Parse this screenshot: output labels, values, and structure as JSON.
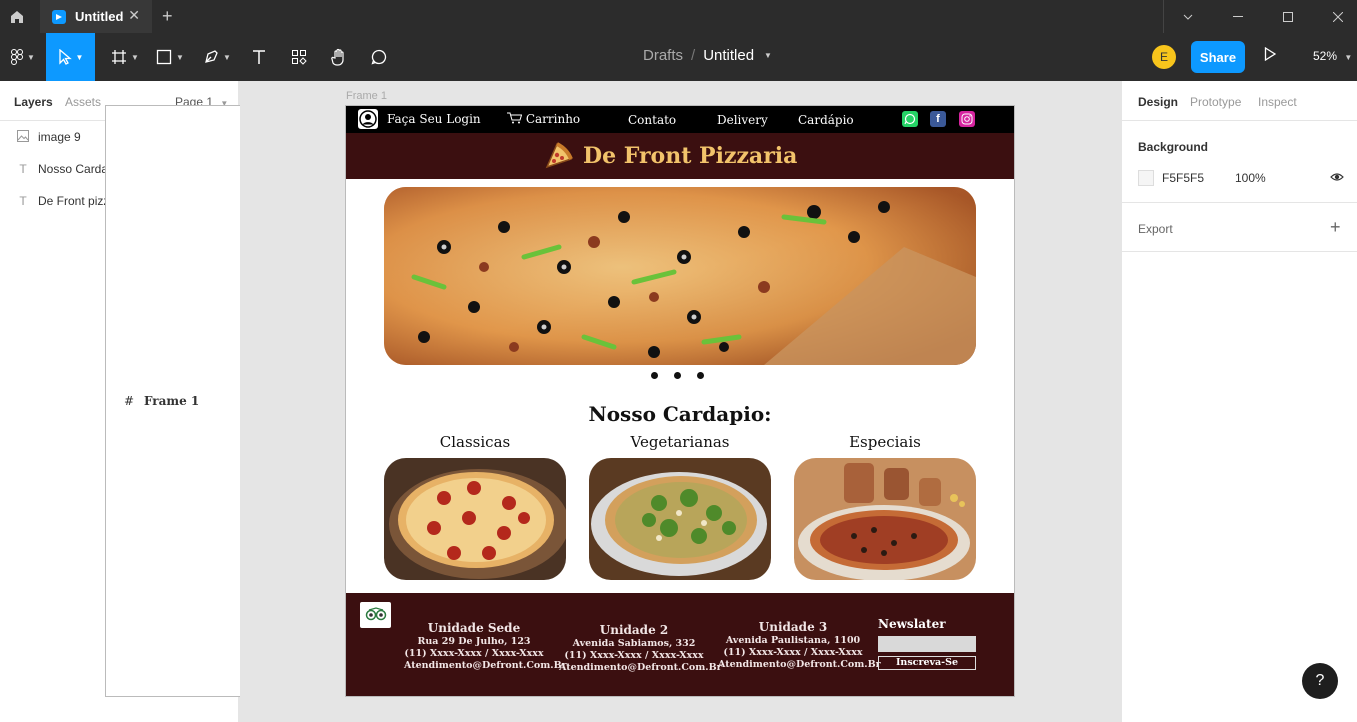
{
  "tab": {
    "title": "Untitled"
  },
  "toolbar": {
    "breadcrumb_parent": "Drafts",
    "breadcrumb_sep": "/",
    "file_name": "Untitled",
    "avatar_initial": "E",
    "share_label": "Share",
    "zoom": "52%"
  },
  "left_panel": {
    "tab_layers": "Layers",
    "tab_assets": "Assets",
    "page": "Page 1",
    "layers": [
      {
        "name": "image 9",
        "type": "image"
      },
      {
        "name": "Nosso Cardapio:",
        "type": "text"
      },
      {
        "name": "De Front pizzaria",
        "type": "text"
      },
      {
        "name": "Frame 1",
        "type": "frame"
      }
    ]
  },
  "right_panel": {
    "tab_design": "Design",
    "tab_prototype": "Prototype",
    "tab_inspect": "Inspect",
    "background_label": "Background",
    "background_hex": "F5F5F5",
    "background_opacity": "100%",
    "background_color": "#F5F5F5",
    "export_label": "Export"
  },
  "canvas": {
    "frame_label": "Frame 1",
    "nav": {
      "login": "Faça Seu Login",
      "cart": "Carrinho",
      "contact": "Contato",
      "delivery": "Delivery",
      "menu": "Cardápio"
    },
    "brand": "De Front Pizzaria",
    "menu_title": "Nosso Cardapio:",
    "categories": [
      "Classicas",
      "Vegetarianas",
      "Especiais"
    ],
    "units": [
      {
        "name": "Unidade Sede",
        "address": "Rua 29 De Julho, 123",
        "phone": "(11) Xxxx-Xxxx / Xxxx-Xxxx",
        "email": "Atendimento@Defront.Com.Br"
      },
      {
        "name": "Unidade 2",
        "address": "Avenida Sabiamos, 332",
        "phone": "(11) Xxxx-Xxxx / Xxxx-Xxxx",
        "email": "Atendimento@Defront.Com.Br"
      },
      {
        "name": "Unidade 3",
        "address": "Avenida Paulistana, 1100",
        "phone": "(11) Xxxx-Xxxx / Xxxx-Xxxx",
        "email": "Atendimento@Defront.Com.Br"
      }
    ],
    "newsletter_title": "Newslater",
    "newsletter_button": "Inscreva-Se",
    "colors": {
      "brand_dark": "#3b0f10",
      "brand_gold": "#f2c36b"
    }
  },
  "help": "?"
}
